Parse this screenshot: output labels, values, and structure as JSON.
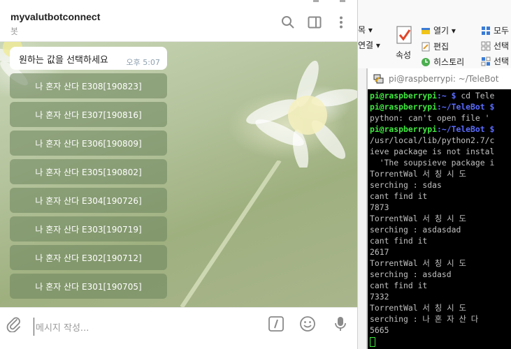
{
  "ribbon": {
    "items": [
      {
        "label": "모두",
        "icon": "select-all-icon"
      },
      {
        "label": "선택",
        "icon": "select-icon"
      },
      {
        "label": "선택",
        "icon": "invert-select-icon"
      },
      {
        "label": "열기 ▾",
        "icon": "open-icon"
      },
      {
        "label": "편집",
        "icon": "edit-icon"
      },
      {
        "label": "히스토리",
        "icon": "history-icon"
      },
      {
        "label": "속성",
        "icon": "properties-icon"
      },
      {
        "label": "목 ▾",
        "icon": ""
      },
      {
        "label": "연결 ▾",
        "icon": ""
      }
    ],
    "scroll_arrow": "▲"
  },
  "terminal": {
    "title": "pi@raspberrypi: ~/TeleBot",
    "lines": [
      [
        {
          "t": "pi@raspberrypi",
          "c": "g"
        },
        {
          "t": ":~ $ ",
          "c": "b"
        },
        {
          "t": "cd Tele",
          "c": ""
        }
      ],
      [
        {
          "t": "pi@raspberrypi",
          "c": "g"
        },
        {
          "t": ":~/TeleBot $",
          "c": "b"
        }
      ],
      [
        {
          "t": "python: can't open file '",
          "c": ""
        }
      ],
      [
        {
          "t": "pi@raspberrypi",
          "c": "g"
        },
        {
          "t": ":~/TeleBot $",
          "c": "b"
        }
      ],
      [
        {
          "t": "/usr/local/lib/python2.7/c",
          "c": ""
        }
      ],
      [
        {
          "t": "ieve package is not instal",
          "c": ""
        }
      ],
      [
        {
          "t": "  'The soupsieve package i",
          "c": ""
        }
      ],
      [
        {
          "t": "TorrentWal 서 칭 시 도",
          "c": ""
        }
      ],
      [
        {
          "t": "serching : sdas",
          "c": ""
        }
      ],
      [
        {
          "t": "cant find it",
          "c": ""
        }
      ],
      [
        {
          "t": "7873",
          "c": ""
        }
      ],
      [
        {
          "t": "TorrentWal 서 칭 시 도",
          "c": ""
        }
      ],
      [
        {
          "t": "serching : asdasdad",
          "c": ""
        }
      ],
      [
        {
          "t": "cant find it",
          "c": ""
        }
      ],
      [
        {
          "t": "2617",
          "c": ""
        }
      ],
      [
        {
          "t": "TorrentWal 서 칭 시 도",
          "c": ""
        }
      ],
      [
        {
          "t": "serching : asdasd",
          "c": ""
        }
      ],
      [
        {
          "t": "cant find it",
          "c": ""
        }
      ],
      [
        {
          "t": "7332",
          "c": ""
        }
      ],
      [
        {
          "t": "TorrentWal 서 칭 시 도",
          "c": ""
        }
      ],
      [
        {
          "t": "serching : 나 혼 자 산 다",
          "c": ""
        }
      ],
      [
        {
          "t": "5665",
          "c": ""
        }
      ]
    ]
  },
  "telegram": {
    "chat_name": "myvalutbotconnect",
    "chat_subtitle": "봇",
    "message": {
      "text": "원하는 값을 선택하세요",
      "time": "오후 5:07"
    },
    "keyboard_buttons": [
      "나 혼자 산다 E308[190823]",
      "나 혼자 산다 E307[190816]",
      "나 혼자 산다 E306[190809]",
      "나 혼자 산다 E305[190802]",
      "나 혼자 산다 E304[190726]",
      "나 혼자 산다 E303[190719]",
      "나 혼자 산다 E302[190712]",
      "나 혼자 산다 E301[190705]"
    ],
    "input_placeholder": "메시지 작성...",
    "colors": {
      "accent": "#5e9ed6",
      "icon_gray": "#8a8a8a",
      "keyboard_button_bg": "#6e875f"
    }
  }
}
